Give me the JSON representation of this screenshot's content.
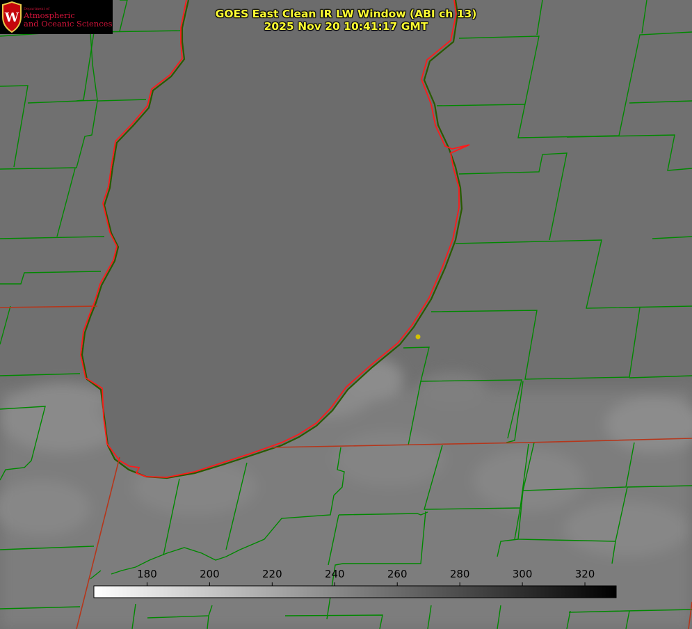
{
  "header": {
    "title_line1": "GOES East Clean IR LW Window (ABI ch 13)",
    "title_line2": "2025 Nov 20 10:41:17 GMT"
  },
  "logo": {
    "emblem_letter": "W",
    "small_text": "Department of",
    "line1": "Atmospheric",
    "line2": "and Oceanic Sciences"
  },
  "colorbar": {
    "ticks": [
      "180",
      "200",
      "220",
      "240",
      "260",
      "280",
      "300",
      "320"
    ],
    "min": 163,
    "max": 330,
    "gradient": "white-to-black"
  },
  "colors": {
    "title": "#ffff33",
    "lake_outline": "#ff1a1a",
    "boundaries": "#008800",
    "state_line": "#c0341a",
    "marker": "#d4c200",
    "logo_red": "#d2143a",
    "background_gray": "#6f6f6f"
  },
  "icons": {
    "logo": "uw-crest-icon",
    "marker": "station-dot-icon"
  }
}
